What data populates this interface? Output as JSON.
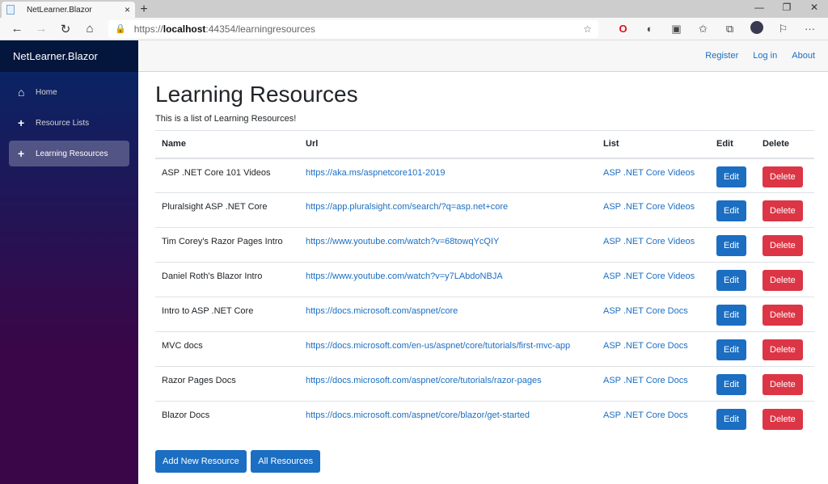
{
  "browser": {
    "tab_title": "NetLearner.Blazor",
    "tab_close": "×",
    "new_tab": "+",
    "url_prefix": "https://",
    "url_host": "localhost",
    "url_rest": ":44354/learningresources",
    "window_controls": {
      "minimize": "—",
      "restore": "❐",
      "close": "✕"
    },
    "nav": {
      "back": "←",
      "forward": "→",
      "refresh": "↻",
      "home": "⌂"
    },
    "icons": {
      "lock": "🔒",
      "star": "☆",
      "opera": "O",
      "circle": "◐",
      "collections_box": "▣",
      "favorites": "✩",
      "collections": "⧉",
      "feedback": "⚐",
      "more": "···"
    }
  },
  "sidebar": {
    "brand": "NetLearner.Blazor",
    "items": [
      {
        "label": "Home",
        "icon": "⌂",
        "active": false
      },
      {
        "label": "Resource Lists",
        "icon": "+",
        "active": false
      },
      {
        "label": "Learning Resources",
        "icon": "+",
        "active": true
      }
    ]
  },
  "topbar": {
    "links": [
      "Register",
      "Log in",
      "About"
    ]
  },
  "page": {
    "title": "Learning Resources",
    "subtitle": "This is a list of Learning Resources!"
  },
  "table": {
    "headers": [
      "Name",
      "Url",
      "List",
      "Edit",
      "Delete"
    ],
    "edit_label": "Edit",
    "delete_label": "Delete",
    "rows": [
      {
        "name": "ASP .NET Core 101 Videos",
        "url": "https://aka.ms/aspnetcore101-2019",
        "list": "ASP .NET Core Videos"
      },
      {
        "name": "Pluralsight ASP .NET Core",
        "url": "https://app.pluralsight.com/search/?q=asp.net+core",
        "list": "ASP .NET Core Videos"
      },
      {
        "name": "Tim Corey's Razor Pages Intro",
        "url": "https://www.youtube.com/watch?v=68towqYcQIY",
        "list": "ASP .NET Core Videos"
      },
      {
        "name": "Daniel Roth's Blazor Intro",
        "url": "https://www.youtube.com/watch?v=y7LAbdoNBJA",
        "list": "ASP .NET Core Videos"
      },
      {
        "name": "Intro to ASP .NET Core",
        "url": "https://docs.microsoft.com/aspnet/core",
        "list": "ASP .NET Core Docs"
      },
      {
        "name": "MVC docs",
        "url": "https://docs.microsoft.com/en-us/aspnet/core/tutorials/first-mvc-app",
        "list": "ASP .NET Core Docs"
      },
      {
        "name": "Razor Pages Docs",
        "url": "https://docs.microsoft.com/aspnet/core/tutorials/razor-pages",
        "list": "ASP .NET Core Docs"
      },
      {
        "name": "Blazor Docs",
        "url": "https://docs.microsoft.com/aspnet/core/blazor/get-started",
        "list": "ASP .NET Core Docs"
      }
    ]
  },
  "actions": {
    "add_new": "Add New Resource",
    "all_resources": "All Resources"
  },
  "colors": {
    "primary": "#1b6ec2",
    "danger": "#dc3545",
    "sidebar_top": "#052767",
    "sidebar_bottom": "#3a0647"
  }
}
